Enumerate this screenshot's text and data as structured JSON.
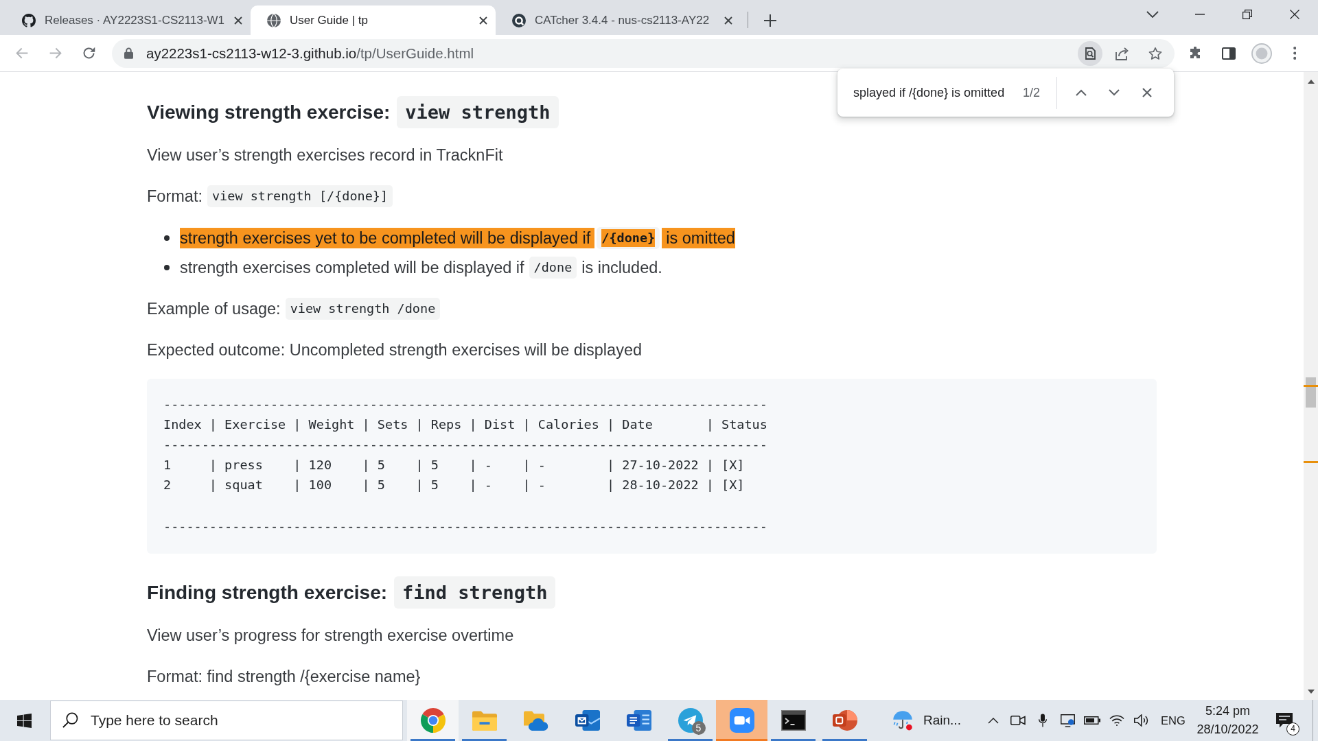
{
  "browser": {
    "tabs": [
      {
        "kind": "cat",
        "title": "Releases · AY2223S1-CS2113-W1",
        "selected": false
      },
      {
        "kind": "globe",
        "title": "User Guide | tp",
        "selected": true
      },
      {
        "kind": "ring",
        "title": "CATcher 3.4.4 - nus-cs2113-AY22",
        "selected": false
      }
    ],
    "nav": [
      {
        "kind": "back",
        "disabled": true
      },
      {
        "kind": "forward",
        "disabled": true
      },
      {
        "kind": "reload",
        "disabled": false
      }
    ],
    "address": {
      "host": "ay2223s1-cs2113-w12-3.github.io",
      "path": "/tp/UserGuide.html"
    },
    "find_bar": {
      "value": "splayed if /{done} is omitted",
      "count": "1/2"
    }
  },
  "page": {
    "blocks": [
      {
        "kind": "heading",
        "parts": [
          {
            "kind": "text",
            "text": "Viewing strength exercise:"
          },
          {
            "kind": "code",
            "text": "view strength"
          }
        ]
      },
      {
        "kind": "paragraph",
        "parts": [
          {
            "kind": "text",
            "text": "View user’s strength exercises record in TracknFit"
          }
        ]
      },
      {
        "kind": "paragraph",
        "parts": [
          {
            "kind": "text",
            "text": "Format:"
          },
          {
            "kind": "code",
            "text": "view strength [/{done}]"
          }
        ]
      },
      {
        "kind": "list",
        "items": [
          {
            "current_match": true,
            "parts": [
              {
                "kind": "text",
                "text": "strength exercises yet to be completed will be displayed if"
              },
              {
                "kind": "code",
                "text": "/{done}"
              },
              {
                "kind": "text",
                "text": "is omitted"
              }
            ]
          },
          {
            "current_match": false,
            "parts": [
              {
                "kind": "text",
                "text": "strength exercises completed will be displayed if"
              },
              {
                "kind": "code",
                "text": "/done"
              },
              {
                "kind": "text",
                "text": "is included."
              }
            ]
          }
        ]
      },
      {
        "kind": "paragraph",
        "parts": [
          {
            "kind": "text",
            "text": "Example of usage:"
          },
          {
            "kind": "code",
            "text": "view strength /done"
          }
        ]
      },
      {
        "kind": "paragraph",
        "parts": [
          {
            "kind": "text",
            "text": "Expected outcome: Uncompleted strength exercises will be displayed"
          }
        ]
      },
      {
        "kind": "code_block",
        "text": "-------------------------------------------------------------------------------\nIndex | Exercise | Weight | Sets | Reps | Dist | Calories | Date       | Status\n-------------------------------------------------------------------------------\n1     | press    | 120    | 5    | 5    | -    | -        | 27-10-2022 | [X]\n2     | squat    | 100    | 5    | 5    | -    | -        | 28-10-2022 | [X]\n\n-------------------------------------------------------------------------------"
      },
      {
        "kind": "heading",
        "parts": [
          {
            "kind": "text",
            "text": "Finding strength exercise:"
          },
          {
            "kind": "code",
            "text": "find strength"
          }
        ]
      },
      {
        "kind": "paragraph",
        "parts": [
          {
            "kind": "text",
            "text": "View user’s progress for strength exercise overtime"
          }
        ]
      },
      {
        "kind": "paragraph",
        "parts": [
          {
            "kind": "text",
            "text": "Format: find strength /{exercise name}"
          }
        ]
      }
    ]
  },
  "taskbar": {
    "search_placeholder": "Type here to search",
    "apps": [
      {
        "kind": "browser",
        "running": true,
        "focused": true,
        "attention": false
      },
      {
        "kind": "folder",
        "running": true,
        "focused": false,
        "attention": false
      },
      {
        "kind": "cloud",
        "running": false,
        "focused": false,
        "attention": false
      },
      {
        "kind": "mail",
        "running": false,
        "focused": false,
        "attention": false
      },
      {
        "kind": "document",
        "running": false,
        "focused": false,
        "attention": false
      },
      {
        "kind": "messenger",
        "running": true,
        "focused": false,
        "attention": false,
        "badge": "5"
      },
      {
        "kind": "video",
        "running": true,
        "focused": false,
        "attention": true
      },
      {
        "kind": "terminal",
        "running": true,
        "focused": false,
        "attention": false
      },
      {
        "kind": "slides",
        "running": true,
        "focused": false,
        "attention": false
      }
    ],
    "weather": "Rain...",
    "language": "ENG",
    "time": "5:24 pm",
    "date": "28/10/2022",
    "notification_count": "4"
  }
}
